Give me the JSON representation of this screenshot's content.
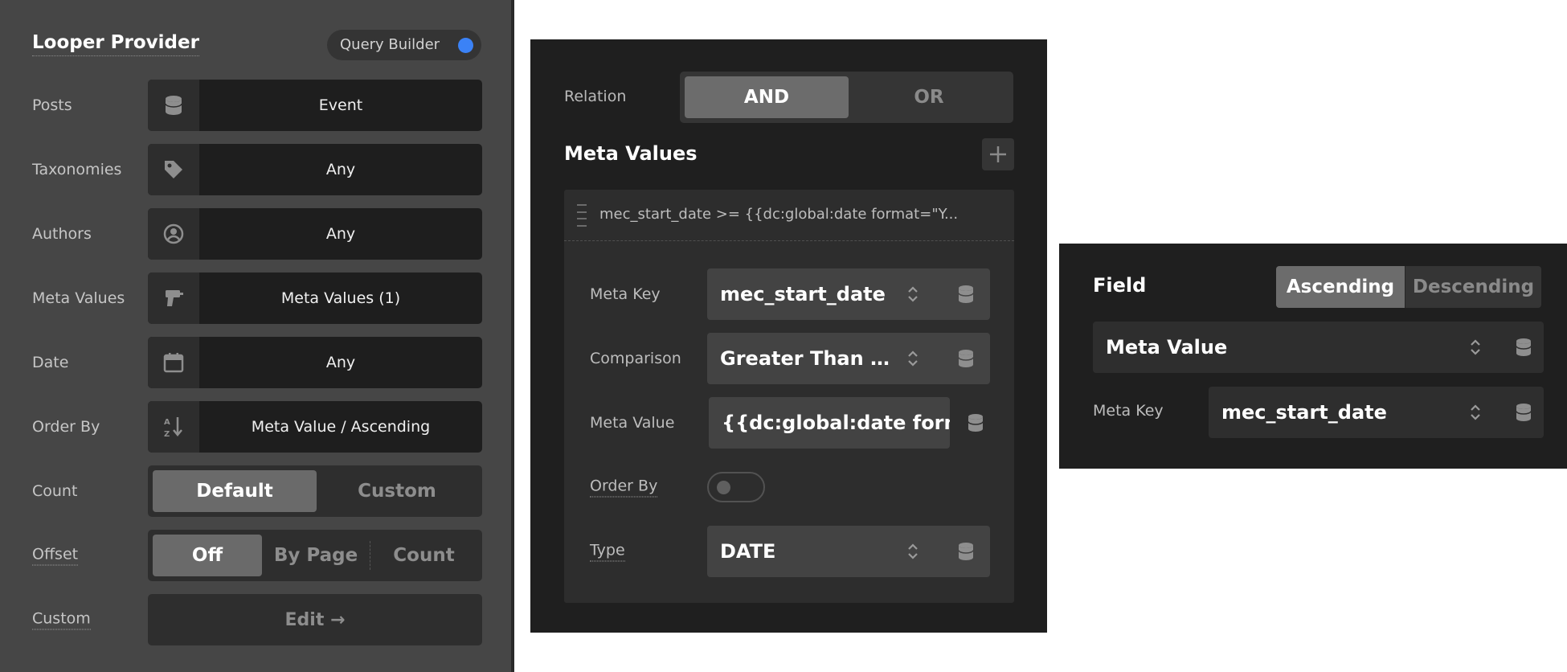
{
  "left_panel": {
    "title": "Looper Provider",
    "query_builder_label": "Query Builder",
    "accent_color": "#3b82f6",
    "rows": [
      {
        "label": "Posts",
        "icon": "database-icon",
        "value": "Event"
      },
      {
        "label": "Taxonomies",
        "icon": "tag-icon",
        "value": "Any"
      },
      {
        "label": "Authors",
        "icon": "user-circle-icon",
        "value": "Any"
      },
      {
        "label": "Meta Values",
        "icon": "drill-icon",
        "value": "Meta Values (1)"
      },
      {
        "label": "Date",
        "icon": "calendar-icon",
        "value": "Any"
      },
      {
        "label": "Order By",
        "icon": "sort-az-icon",
        "value": "Meta Value / Ascending"
      }
    ],
    "count": {
      "label": "Count",
      "options": [
        "Default",
        "Custom"
      ],
      "selected": "Default"
    },
    "offset": {
      "label": "Offset",
      "options": [
        "Off",
        "By Page",
        "Count"
      ],
      "selected": "Off"
    },
    "custom": {
      "label": "Custom",
      "button": "Edit →"
    }
  },
  "meta_panel": {
    "relation": {
      "label": "Relation",
      "options": [
        "AND",
        "OR"
      ],
      "selected": "AND"
    },
    "meta_values_title": "Meta Values",
    "add_icon": "plus-icon",
    "item_summary": "mec_start_date >= {{dc:global:date format=\"Y...",
    "fields": {
      "meta_key": {
        "label": "Meta Key",
        "value": "mec_start_date"
      },
      "comparison": {
        "label": "Comparison",
        "value": "Greater Than Or..."
      },
      "meta_value": {
        "label": "Meta Value",
        "value": "{{dc:global:date format=\"Y-m-d\"}}"
      },
      "order_by": {
        "label": "Order By",
        "enabled": false
      },
      "type": {
        "label": "Type",
        "value": "DATE"
      }
    }
  },
  "order_panel": {
    "title": "Field",
    "direction": {
      "options": [
        "Ascending",
        "Descending"
      ],
      "selected": "Ascending"
    },
    "field_value": "Meta Value",
    "meta_key": {
      "label": "Meta Key",
      "value": "mec_start_date"
    }
  }
}
